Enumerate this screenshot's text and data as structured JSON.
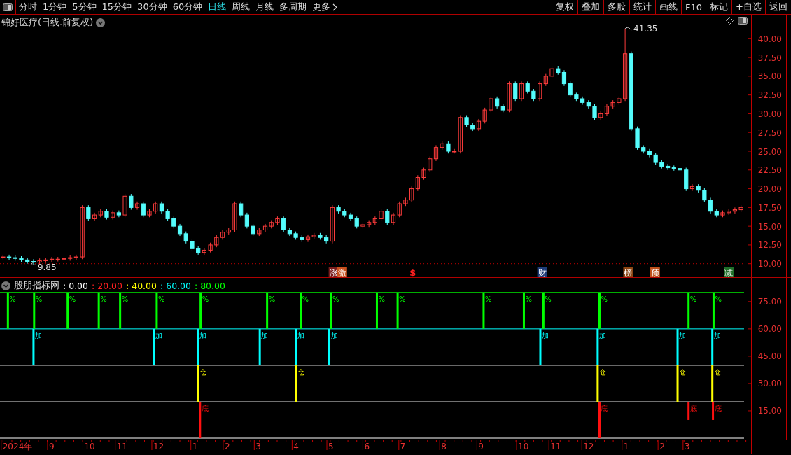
{
  "toolbar": {
    "periods": [
      {
        "label": "分时",
        "selected": false
      },
      {
        "label": "1分钟",
        "selected": false
      },
      {
        "label": "5分钟",
        "selected": false
      },
      {
        "label": "15分钟",
        "selected": false
      },
      {
        "label": "30分钟",
        "selected": false
      },
      {
        "label": "60分钟",
        "selected": false
      },
      {
        "label": "日线",
        "selected": true
      },
      {
        "label": "周线",
        "selected": false
      },
      {
        "label": "月线",
        "selected": false
      },
      {
        "label": "多周期",
        "selected": false
      },
      {
        "label": "更多",
        "selected": false
      }
    ],
    "buttons": [
      "复权",
      "叠加",
      "多股",
      "统计",
      "画线",
      "F10",
      "标记",
      "+自选",
      "返回"
    ]
  },
  "price_chart": {
    "title": "锦好医疗(日线.前复权)",
    "high_label": "41.35",
    "low_label": "9.85",
    "axis_labels": [
      "40.00",
      "37.50",
      "35.00",
      "32.50",
      "30.00",
      "27.50",
      "25.00",
      "22.50",
      "20.00",
      "17.50",
      "15.00",
      "12.50",
      "10.00"
    ],
    "event_tags": [
      {
        "label": "涨",
        "color": "#7a1c1c",
        "kind": "tag"
      },
      {
        "label": "激",
        "color": "#c8501e",
        "kind": "tag"
      },
      {
        "label": "$",
        "color": "#ff2020",
        "kind": "symbol"
      },
      {
        "label": "财",
        "color": "#1e3c78",
        "kind": "tag"
      },
      {
        "label": "榜",
        "color": "#8b4513",
        "kind": "tag"
      },
      {
        "label": "预",
        "color": "#c0501a",
        "kind": "tag"
      },
      {
        "label": "减",
        "color": "#1e6e28",
        "kind": "tag"
      }
    ]
  },
  "indicator": {
    "name": "股朋指标网",
    "levels": [
      {
        "text": ": 0.00",
        "color": "#ffffff"
      },
      {
        "text": ": 20.00",
        "color": "#ff2020"
      },
      {
        "text": ": 40.00",
        "color": "#ffff00"
      },
      {
        "text": ": 60.00",
        "color": "#00ffff"
      },
      {
        "text": ": 80.00",
        "color": "#00ff00"
      }
    ],
    "axis_labels": [
      "75.00",
      "60.00",
      "45.00",
      "30.00",
      "15.00"
    ],
    "signal_rows": [
      {
        "color": "#00ff00",
        "labels": [
          "%",
          "%",
          "%",
          "%",
          "%",
          "%",
          "%",
          "%",
          "%",
          "%",
          "%",
          "%",
          "%",
          "%",
          "%",
          "%",
          "%",
          "%"
        ]
      },
      {
        "color": "#00ffff",
        "labels": [
          "加",
          "加",
          "加",
          "加",
          "加",
          "加",
          "加",
          "加",
          "加",
          "加"
        ]
      },
      {
        "color": "#ffff00",
        "labels": [
          "仓",
          "仓",
          "仓",
          "仓",
          "仓"
        ]
      },
      {
        "color": "#ff1010",
        "labels": [
          "底",
          "底",
          "底",
          "底"
        ]
      }
    ]
  },
  "date_axis": [
    "2024年",
    "9",
    "10",
    "11",
    "12",
    "1",
    "2",
    "3",
    "4",
    "5",
    "6",
    "7",
    "8",
    "9",
    "10",
    "11",
    "12",
    "1",
    "2",
    "3"
  ]
}
